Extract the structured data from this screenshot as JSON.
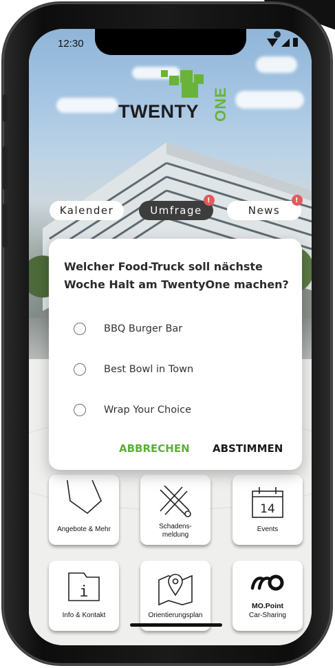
{
  "status_bar": {
    "time": "12:30"
  },
  "logo": {
    "text": "TWENTY",
    "accent_text": "ONE"
  },
  "tabs": [
    {
      "label": "Kalender",
      "active": false,
      "badge": ""
    },
    {
      "label": "Umfrage",
      "active": true,
      "badge": "!"
    },
    {
      "label": "News",
      "active": false,
      "badge": "!"
    }
  ],
  "poll_dialog": {
    "question": "Welcher Food-Truck soll nächste Woche Halt am TwentyOne machen?",
    "options": [
      "BBQ Burger Bar",
      "Best Bowl in Town",
      "Wrap Your Choice"
    ],
    "cancel_label": "ABBRECHEN",
    "submit_label": "ABSTIMMEN"
  },
  "tiles": [
    {
      "label": "Angebote & Mehr",
      "icon": "tag-icon"
    },
    {
      "label": "Schadens-\nmeldung",
      "icon": "tools-icon"
    },
    {
      "label": "Events",
      "icon": "calendar-icon",
      "icon_text": "14"
    },
    {
      "label": "Info & Kontakt",
      "icon": "info-folder-icon",
      "icon_text": "i"
    },
    {
      "label": "Orientierungsplan",
      "icon": "map-pin-icon"
    },
    {
      "label": "Car-Sharing",
      "icon": "mo-point-logo-icon",
      "icon_text": "MO.Point"
    }
  ],
  "colors": {
    "accent_green": "#6ab33a",
    "cancel_green": "#5bb038",
    "badge_red": "#e25b5b",
    "active_tab": "#3d3d3d"
  }
}
